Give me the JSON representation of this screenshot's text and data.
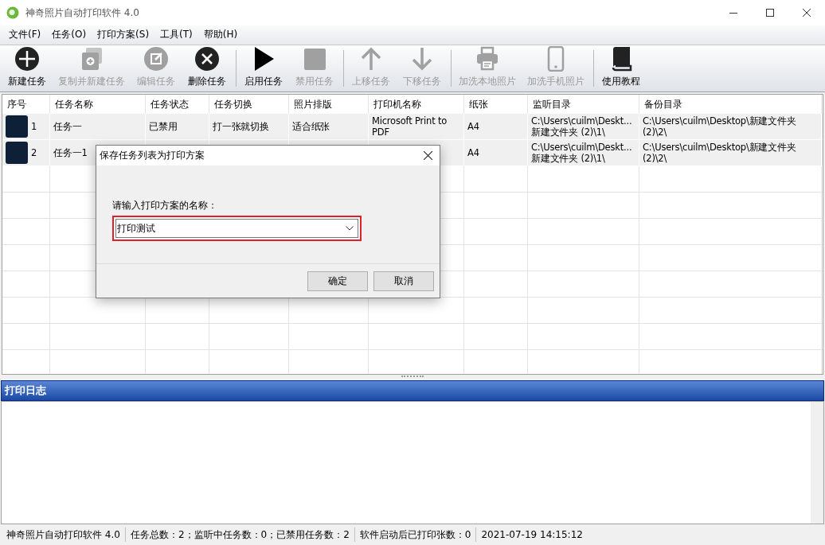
{
  "window": {
    "title": "神奇照片自动打印软件 4.0"
  },
  "menu": [
    "文件(F)",
    "任务(O)",
    "打印方案(S)",
    "工具(T)",
    "帮助(H)"
  ],
  "toolbar": [
    [
      {
        "kind": "plus",
        "label": "新建任务",
        "disabled": false
      },
      {
        "kind": "copy",
        "label": "复制并新建任务",
        "disabled": true
      },
      {
        "kind": "edit",
        "label": "编辑任务",
        "disabled": true
      },
      {
        "kind": "delete",
        "label": "删除任务",
        "disabled": false
      }
    ],
    [
      {
        "kind": "play",
        "label": "启用任务",
        "disabled": false
      },
      {
        "kind": "stop",
        "label": "禁用任务",
        "disabled": true
      }
    ],
    [
      {
        "kind": "up",
        "label": "上移任务",
        "disabled": true
      },
      {
        "kind": "down",
        "label": "下移任务",
        "disabled": true
      }
    ],
    [
      {
        "kind": "printer",
        "label": "加洗本地照片",
        "disabled": true
      },
      {
        "kind": "phone",
        "label": "加洗手机照片",
        "disabled": true
      }
    ],
    [
      {
        "kind": "book",
        "label": "使用教程",
        "disabled": false
      }
    ]
  ],
  "table": {
    "columns": [
      "序号",
      "任务名称",
      "任务状态",
      "任务切换",
      "照片排版",
      "打印机名称",
      "纸张",
      "监听目录",
      "备份目录"
    ],
    "rows": [
      {
        "cells": [
          "1",
          "任务一",
          "已禁用",
          "打一张就切换",
          "适合纸张",
          "Microsoft Print to PDF",
          "A4",
          "C:\\Users\\cuilm\\Deskt... 新建文件夹 (2)\\1\\",
          "C:\\Users\\cuilm\\Desktop\\新建文件夹 (2)\\2\\"
        ]
      },
      {
        "cells": [
          "2",
          "任务一1",
          "",
          "",
          "",
          "",
          "A4",
          "C:\\Users\\cuilm\\Deskt... 新建文件夹 (2)\\1\\",
          "C:\\Users\\cuilm\\Desktop\\新建文件夹 (2)\\2\\"
        ]
      }
    ]
  },
  "log_panel": {
    "title": "打印日志"
  },
  "status_bar": [
    "神奇照片自动打印软件 4.0",
    "任务总数：2；监听中任务数：0；已禁用任务数：2",
    "软件启动后已打印张数：0",
    "2021-07-19 14:15:12"
  ],
  "dialog": {
    "title": "保存任务列表为打印方案",
    "label": "请输入打印方案的名称：",
    "value": "打印测试",
    "buttons": [
      "确定",
      "取消"
    ]
  }
}
